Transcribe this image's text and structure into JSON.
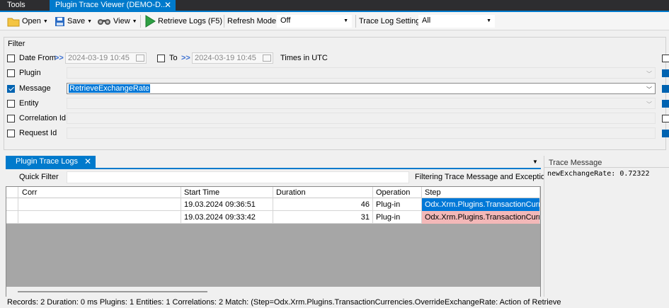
{
  "tabs": {
    "tools": "Tools",
    "document": "Plugin Trace Viewer (DEMO-D...",
    "close": "✕"
  },
  "toolbar": {
    "open": "Open",
    "save": "Save",
    "view": "View",
    "retrieve": "Retrieve Logs (F5)",
    "refresh_mode_label": "Refresh Mode",
    "refresh_mode_value": "Off",
    "trace_log_label": "Trace Log Setting",
    "trace_log_value": "All"
  },
  "filter": {
    "title": "Filter",
    "date_from": {
      "label": "Date From",
      "checked": false,
      "arrows": ">>",
      "value": "2024-03-19 10:45"
    },
    "date_to": {
      "label": "To",
      "checked": false,
      "arrows": ">>",
      "value": "2024-03-19 10:45"
    },
    "times_in": "Times in UTC",
    "plugin": {
      "label": "Plugin",
      "checked": false,
      "value": ""
    },
    "message": {
      "label": "Message",
      "checked": true,
      "value": "RetrieveExchangeRate"
    },
    "entity": {
      "label": "Entity",
      "checked": false,
      "value": ""
    },
    "correlation": {
      "label": "Correlation Id",
      "checked": false,
      "value": ""
    },
    "request": {
      "label": "Request Id",
      "checked": true,
      "value": ""
    }
  },
  "logs": {
    "tab_label": "Plugin Trace Logs",
    "close": "✕",
    "quick_filter_label": "Quick Filter",
    "quick_filter_value": "",
    "filter_hint": "Filtering Trace Message and Exception",
    "columns": [
      "Corr",
      "Start Time",
      "Duration",
      "Operation",
      "Step"
    ],
    "rows": [
      {
        "corr": "",
        "start": "19.03.2024 09:36:51",
        "duration": "46",
        "operation": "Plug-in",
        "step": "Odx.Xrm.Plugins.TransactionCurrencies"
      },
      {
        "corr": "",
        "start": "19.03.2024 09:33:42",
        "duration": "31",
        "operation": "Plug-in",
        "step": "Odx.Xrm.Plugins.TransactionCurrencies"
      }
    ]
  },
  "trace": {
    "title": "Trace Message",
    "message": "newExchangeRate: 0.72322"
  },
  "status": "Records: 2  Duration: 0 ms  Plugins: 1  Entities: 1  Correlations: 2  Match: (Step=Odx.Xrm.Plugins.TransactionCurrencies.OverrideExchangeRate: Action of Retrieve"
}
